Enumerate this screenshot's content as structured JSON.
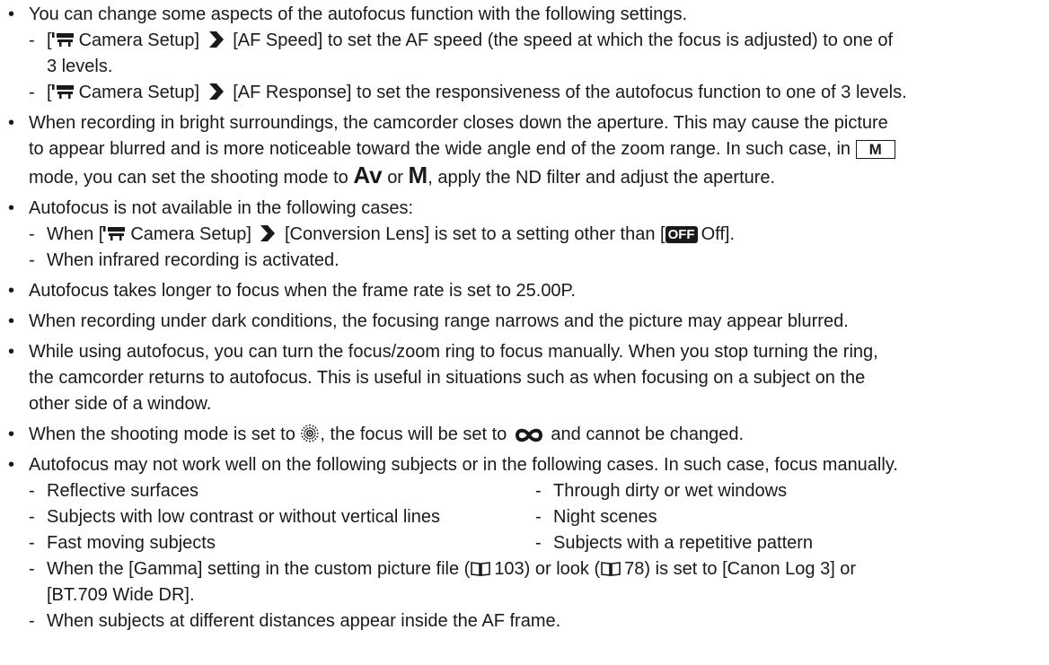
{
  "bullet_glyph": "•",
  "dash_glyph": "-",
  "p1": {
    "text": "You can change some aspects of the autofocus function with the following settings.",
    "sub1": {
      "open": "[",
      "menu": "Camera Setup]",
      "item": "[AF Speed] to set the AF speed (the speed at which the focus is adjusted) to one of",
      "cont": "3 levels."
    },
    "sub2": {
      "open": "[",
      "menu": "Camera Setup]",
      "item": "[AF Response] to set the responsiveness of the autofocus function to one of 3 levels."
    }
  },
  "p2": {
    "line1": "When recording in bright surroundings, the camcorder closes down the aperture. This may cause the picture",
    "line2": "to appear blurred and is more noticeable toward the wide angle end of the zoom range. In such case, in",
    "mode_box": "M",
    "line3a": "mode, you can set the shooting mode to",
    "av": "Av",
    "or": "or",
    "m": "M",
    "line3b": ", apply the ND filter and adjust the aperture."
  },
  "p3": {
    "text": "Autofocus is not available in the following cases:",
    "sub1": {
      "pre": "When [",
      "menu": "Camera Setup]",
      "item": "[Conversion Lens] is set to a setting other than [",
      "off_icon": "OFF",
      "end": "Off]."
    },
    "sub2": "When infrared recording is activated."
  },
  "p4": "Autofocus takes longer to focus when the frame rate is set to 25.00P.",
  "p5": "When recording under dark conditions, the focusing range narrows and the picture may appear blurred.",
  "p6": [
    "While using autofocus, you can turn the focus/zoom ring to focus manually. When you stop turning the ring,",
    "the camcorder returns to autofocus. This is useful in situations such as when focusing on a subject on the",
    "other side of a window."
  ],
  "p7": {
    "a": "When the shooting mode is set to",
    "b": ", the focus will be set to",
    "c": "and cannot be changed."
  },
  "p8": {
    "text": "Autofocus may not work well on the following subjects or in the following cases. In such case, focus manually.",
    "left": [
      "Reflective surfaces",
      "Subjects with low contrast or without vertical lines",
      "Fast moving subjects"
    ],
    "right": [
      "Through dirty or wet windows",
      "Night scenes",
      "Subjects with a repetitive pattern"
    ],
    "gamma": {
      "a": "When the [Gamma] setting in the custom picture file (",
      "ref1": "103) or look (",
      "ref2": "78) is set to [Canon Log 3] or",
      "cont": "[BT.709 Wide DR]."
    },
    "last": "When subjects at different distances appear inside the AF frame."
  },
  "icons": {
    "camera": "camera-setup-icon",
    "arrow": "chevron-right-icon",
    "book": "book-reference-icon",
    "sun": "fireworks-icon",
    "infinity": "infinity-icon"
  }
}
